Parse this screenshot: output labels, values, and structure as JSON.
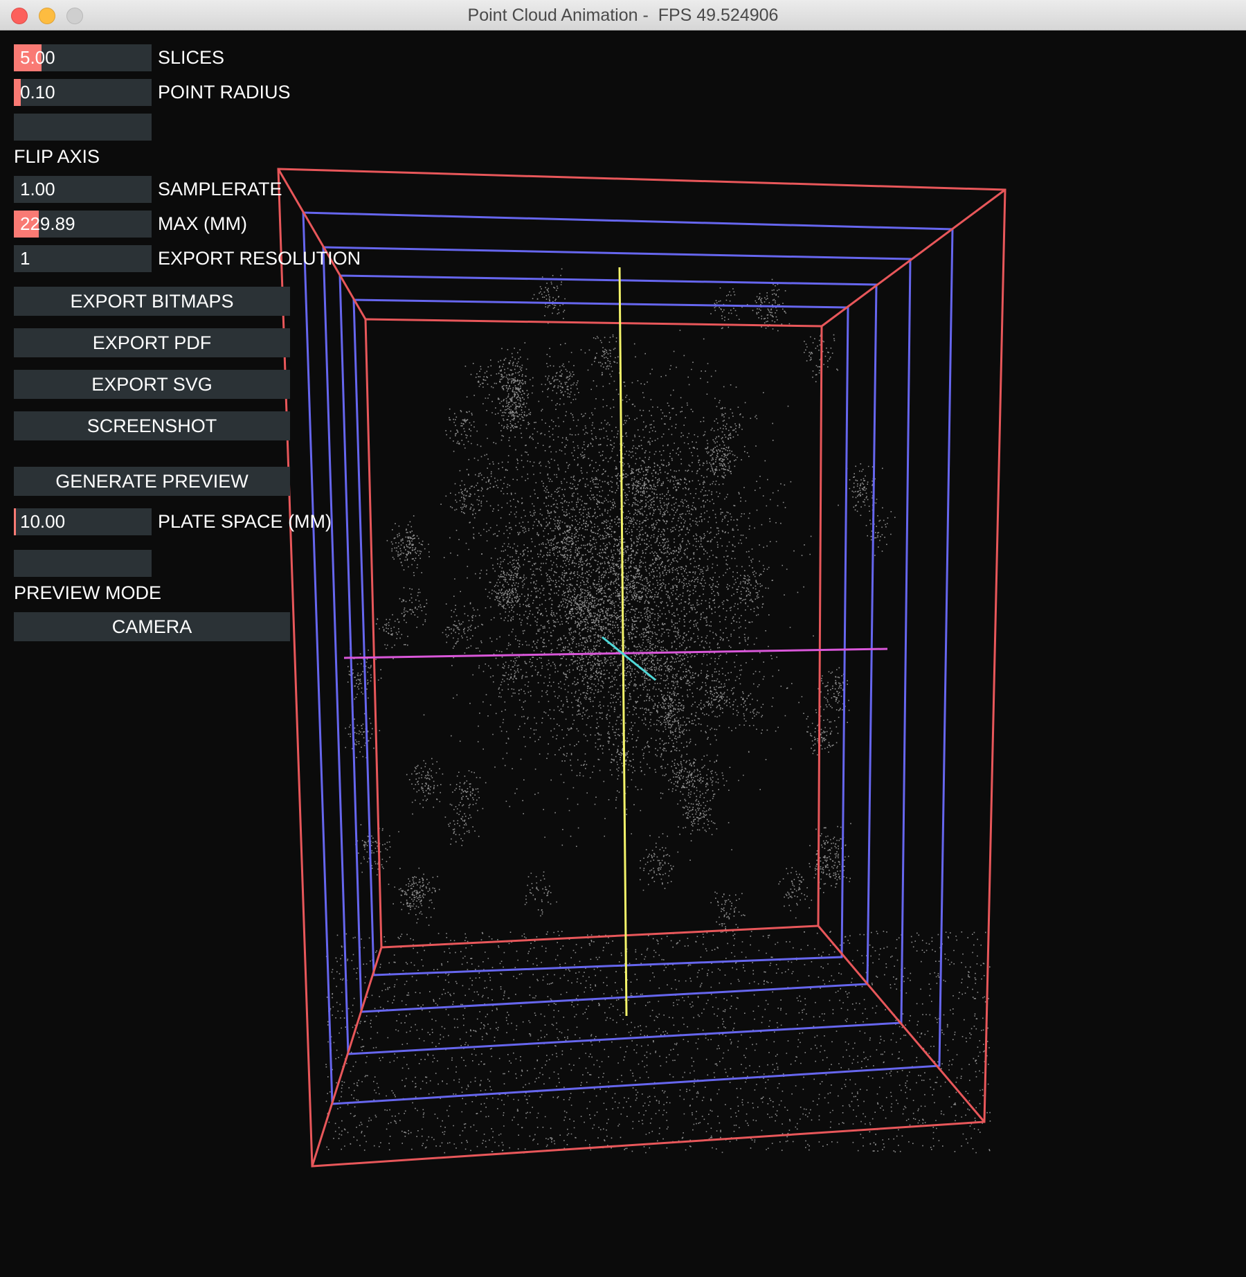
{
  "window": {
    "title": "Point Cloud Animation -  FPS 49.524906"
  },
  "colors": {
    "background": "#0b0b0b",
    "panel": "#2b3236",
    "slider_fill": "#f97a74",
    "bbox_outer": "#e8575a",
    "bbox_inner": "#6666ee",
    "axis_y": "#f4f46a",
    "axis_x": "#d957d9",
    "axis_z": "#4fd8d8",
    "points": "#ffffff"
  },
  "controls": {
    "slices": {
      "value": "5.00",
      "label": "SLICES",
      "fill": 0.2
    },
    "point_radius": {
      "value": "0.10",
      "label": "POINT RADIUS",
      "fill": 0.05
    },
    "flip_axis": {
      "label": "FLIP AXIS"
    },
    "samplerate": {
      "value": "1.00",
      "label": "SAMPLERATE",
      "fill": 0.0
    },
    "max_mm": {
      "value": "229.89",
      "label": "MAX (MM)",
      "fill": 0.18
    },
    "export_resolution": {
      "value": "1",
      "label": "EXPORT RESOLUTION",
      "fill": 0.0
    },
    "plate_space": {
      "value": "10.00",
      "label": "PLATE SPACE (MM)",
      "fill": 0.015
    },
    "preview_mode": {
      "label": "PREVIEW MODE"
    }
  },
  "buttons": {
    "export_bitmaps": "EXPORT BITMAPS",
    "export_pdf": "EXPORT PDF",
    "export_svg": "EXPORT SVG",
    "screenshot": "SCREENSHOT",
    "generate_preview": "GENERATE PREVIEW",
    "camera": "CAMERA"
  }
}
